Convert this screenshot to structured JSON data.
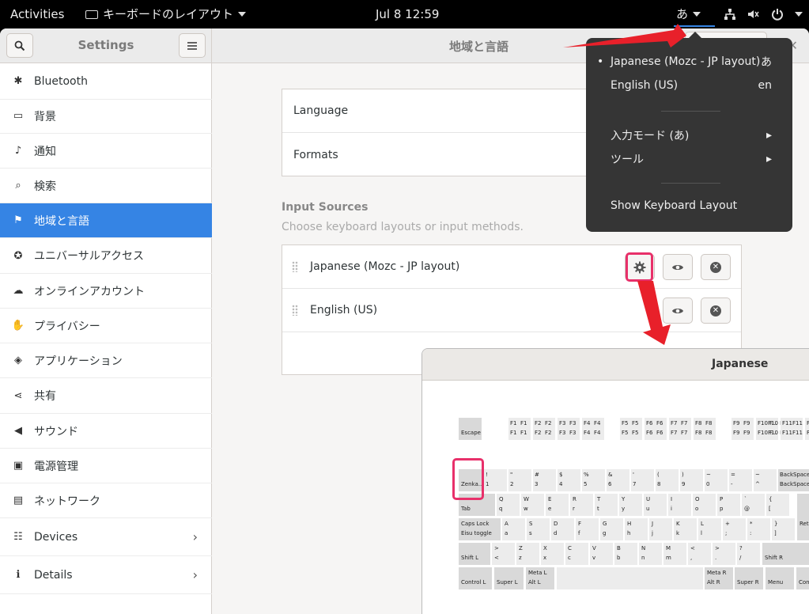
{
  "topbar": {
    "activities": "Activities",
    "app_menu": "キーボードのレイアウト",
    "clock": "Jul 8  12:59",
    "ime_indicator": "あ"
  },
  "sidebar": {
    "title": "Settings",
    "items": [
      {
        "label": "Bluetooth",
        "icon": "bluetooth-icon",
        "glyph": "✱"
      },
      {
        "label": "背景",
        "icon": "background-icon",
        "glyph": "▭"
      },
      {
        "label": "通知",
        "icon": "bell-icon",
        "glyph": "♪"
      },
      {
        "label": "検索",
        "icon": "search-icon",
        "glyph": "⌕"
      },
      {
        "label": "地域と言語",
        "icon": "flag-icon",
        "glyph": "⚑"
      },
      {
        "label": "ユニバーサルアクセス",
        "icon": "accessibility-icon",
        "glyph": "✪"
      },
      {
        "label": "オンラインアカウント",
        "icon": "cloud-icon",
        "glyph": "☁"
      },
      {
        "label": "プライバシー",
        "icon": "hand-icon",
        "glyph": "✋"
      },
      {
        "label": "アプリケーション",
        "icon": "applications-icon",
        "glyph": "◈"
      },
      {
        "label": "共有",
        "icon": "share-icon",
        "glyph": "⋖"
      },
      {
        "label": "サウンド",
        "icon": "speaker-icon",
        "glyph": "◀"
      },
      {
        "label": "電源管理",
        "icon": "power-icon",
        "glyph": "▣"
      },
      {
        "label": "ネットワーク",
        "icon": "network-icon",
        "glyph": "▤"
      },
      {
        "label": "Devices",
        "icon": "devices-icon",
        "glyph": "☷"
      },
      {
        "label": "Details",
        "icon": "info-icon",
        "glyph": "ℹ"
      }
    ]
  },
  "main": {
    "title": "地域と言語",
    "language_label": "Language",
    "formats_label": "Formats",
    "input_sources_title": "Input Sources",
    "input_sources_subtitle": "Choose keyboard layouts or input methods.",
    "sources": [
      {
        "label": "Japanese (Mozc - JP layout)"
      },
      {
        "label": "English (US)"
      }
    ]
  },
  "popup": {
    "items": [
      {
        "label": "Japanese (Mozc - JP layout)",
        "right": "あ"
      },
      {
        "label": "English (US)",
        "right": "en"
      },
      {
        "label": "入力モード (あ)",
        "right": "▸"
      },
      {
        "label": "ツール",
        "right": "▸"
      },
      {
        "label": "Show Keyboard Layout",
        "right": ""
      }
    ]
  },
  "keyboard_window": {
    "title": "Japanese",
    "keys": {
      "escape": "Escape",
      "zenkaku": "Zenka...",
      "tab": "Tab",
      "capslock": "Caps Lock",
      "eisu": "Eisu toggle",
      "shift_l": "Shift L",
      "shift_r": "Shift R",
      "control_l": "Control L",
      "super_l": "Super L",
      "meta_l": "Meta L",
      "alt_l": "Alt L",
      "meta_r": "Meta R",
      "alt_r": "Alt R",
      "super_r": "Super R",
      "menu": "Menu",
      "control_r": "Contr...",
      "backspace": "BackSpace",
      "return": "Retu...",
      "f_row": [
        "F1",
        "F2",
        "F3",
        "F4",
        "F5",
        "F6",
        "F7",
        "F8",
        "F9",
        "F10 F...",
        "F11",
        "F12"
      ],
      "num_top": [
        "!",
        "\"",
        "#",
        "$",
        "%",
        "&",
        "'",
        "(",
        ")",
        "~",
        "=",
        "~",
        "|"
      ],
      "num_bottom": [
        "1",
        "2",
        "3",
        "4",
        "5",
        "6",
        "7",
        "8",
        "9",
        "0",
        "-",
        "^",
        "¥"
      ],
      "q_top": [
        "Q",
        "W",
        "E",
        "R",
        "T",
        "Y",
        "U",
        "I",
        "O",
        "P",
        "`",
        "{"
      ],
      "q_bottom": [
        "q",
        "w",
        "e",
        "r",
        "t",
        "y",
        "u",
        "i",
        "o",
        "p",
        "@",
        "["
      ],
      "a_top": [
        "A",
        "S",
        "D",
        "F",
        "G",
        "H",
        "J",
        "K",
        "L",
        "+",
        "*",
        "}"
      ],
      "a_bottom": [
        "a",
        "s",
        "d",
        "f",
        "g",
        "h",
        "j",
        "k",
        "l",
        ";",
        ":",
        "]"
      ],
      "z_top": [
        ">",
        "Z",
        "X",
        "C",
        "V",
        "B",
        "N",
        "M",
        "<",
        ">",
        "?",
        "_"
      ],
      "z_bottom": [
        "<",
        "z",
        "x",
        "c",
        "v",
        "b",
        "n",
        "m",
        ",",
        ".",
        "/",
        "\\"
      ],
      "z_pipe": "¦",
      "z_bar": "|"
    }
  }
}
